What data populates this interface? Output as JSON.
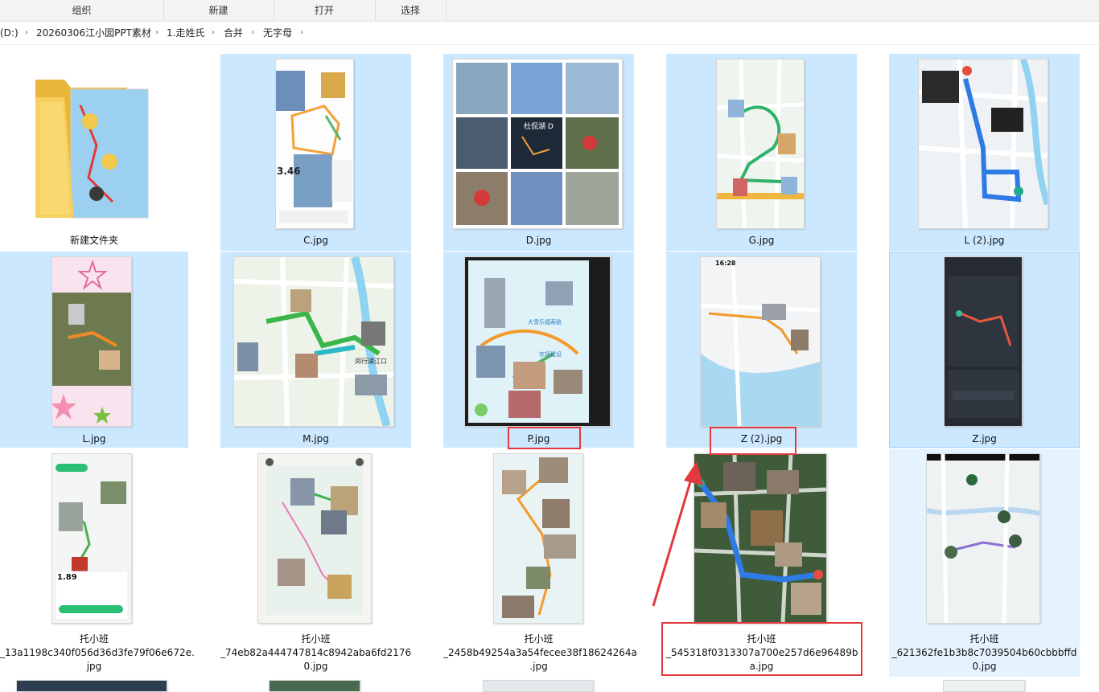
{
  "toolbar": {
    "organize": "组织",
    "new": "新建",
    "open": "打开",
    "select": "选择"
  },
  "breadcrumb": {
    "drive": "(D:)",
    "items": [
      "20260306江小囡PPT素材",
      "1.走姓氏",
      "合并",
      "无字母"
    ]
  },
  "files": [
    {
      "name": "新建文件夹",
      "type": "folder"
    },
    {
      "name": "C.jpg",
      "thumb": "map-route-collage"
    },
    {
      "name": "D.jpg",
      "thumb": "photo-grid"
    },
    {
      "name": "G.jpg",
      "thumb": "map-route-collage"
    },
    {
      "name": "L (2).jpg",
      "thumb": "map-route-collage"
    },
    {
      "name": "L.jpg",
      "thumb": "map-route-collage"
    },
    {
      "name": "M.jpg",
      "thumb": "map-route-collage"
    },
    {
      "name": "P.jpg",
      "thumb": "map-route-collage"
    },
    {
      "name": "Z (2).jpg",
      "thumb": "map-route-collage"
    },
    {
      "name": "Z.jpg",
      "thumb": "dark-app-screenshot"
    },
    {
      "name_line1": "托小班",
      "name_line2": "_13a1198c340f056d36d3fe79f06e672e.",
      "name_line3": "jpg"
    },
    {
      "name_line1": "托小班",
      "name_line2": "_74eb82a444747814c8942aba6fd2176",
      "name_line3": "0.jpg"
    },
    {
      "name_line1": "托小班",
      "name_line2": "_2458b49254a3a54fecee38f18624264a",
      "name_line3": ".jpg"
    },
    {
      "name_line1": "托小班",
      "name_line2": "_545318f0313307a700e257d6e96489b",
      "name_line3": "a.jpg"
    },
    {
      "name_line1": "托小班",
      "name_line2": "_621362fe1b3b8c7039504b60cbbbffd",
      "name_line3": "0.jpg"
    }
  ],
  "thumb_text": {
    "c_distance": "3.46",
    "d_caption": "杜侃湖 D",
    "z2_time": "16:28",
    "m_place": "闵行浦江口",
    "t1_distance": "1.89",
    "p_banner_1": "大雪乐福寿路",
    "p_banner_2": "农场建设"
  },
  "colors": {
    "selection": "#cce8ff",
    "hover": "#e5f3ff",
    "annotation_red": "#e0393e",
    "route_orange": "#f39a2b",
    "route_blue": "#2e7be6",
    "route_green": "#3ab54a"
  }
}
